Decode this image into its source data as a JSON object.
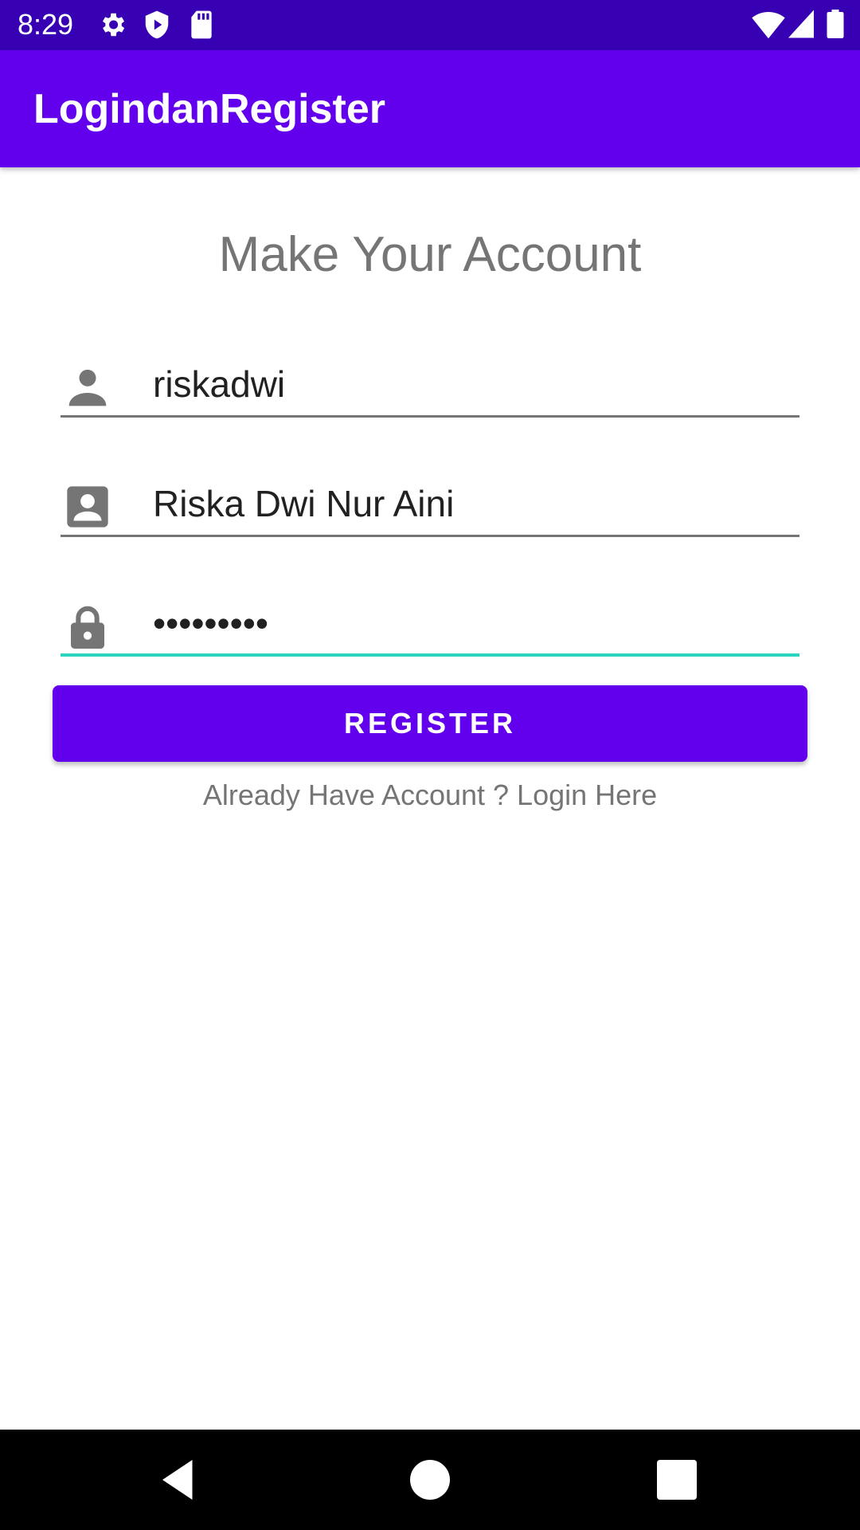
{
  "status_bar": {
    "time": "8:29",
    "icons_left": [
      "gear-icon",
      "shield-play-icon",
      "sd-card-icon"
    ],
    "icons_right": [
      "wifi-icon",
      "signal-icon",
      "battery-icon"
    ],
    "color": "#3700b3"
  },
  "app_bar": {
    "title": "LogindanRegister",
    "color": "#6200ee"
  },
  "form": {
    "heading": "Make Your Account",
    "username": {
      "icon": "person-icon",
      "value": "riskadwi"
    },
    "fullname": {
      "icon": "contact-card-icon",
      "value": "Riska Dwi Nur Aini"
    },
    "password": {
      "icon": "lock-icon",
      "value": "•••••••••"
    },
    "register_label": "REGISTER",
    "login_link": "Already Have Account ? Login Here",
    "focus_color": "#2bd4bd"
  },
  "nav_bar": {
    "buttons": [
      "back-icon",
      "home-icon",
      "recents-icon"
    ]
  }
}
